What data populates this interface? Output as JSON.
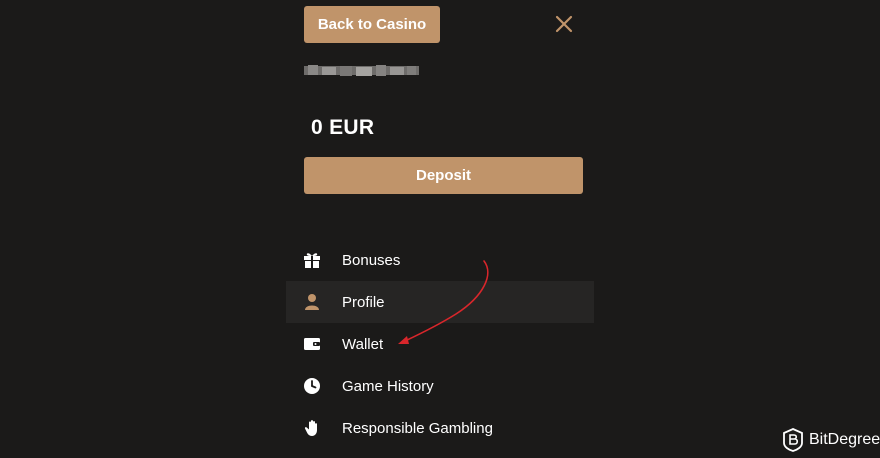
{
  "header": {
    "back_label": "Back to Casino"
  },
  "account": {
    "balance": "0 EUR",
    "deposit_label": "Deposit"
  },
  "menu": {
    "items": [
      {
        "label": "Bonuses",
        "icon": "gift-icon"
      },
      {
        "label": "Profile",
        "icon": "user-icon"
      },
      {
        "label": "Wallet",
        "icon": "wallet-icon"
      },
      {
        "label": "Game History",
        "icon": "clock-icon"
      },
      {
        "label": "Responsible Gambling",
        "icon": "hand-icon"
      }
    ],
    "active_index": 1
  },
  "watermark": {
    "brand_name": "BitDegree"
  },
  "colors": {
    "background": "#1b1a19",
    "accent": "#c0946a",
    "active_row": "#262524",
    "annotation_arrow": "#d9262b"
  }
}
